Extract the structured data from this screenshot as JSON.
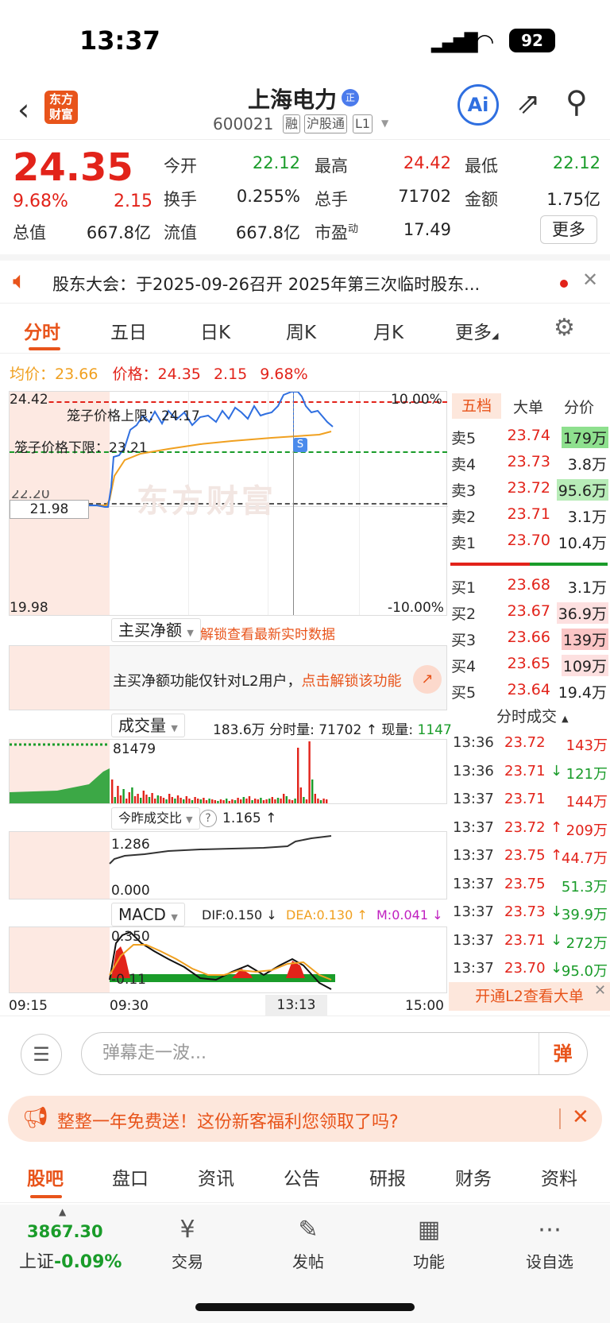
{
  "status": {
    "time": "13:37",
    "battery": "92"
  },
  "header": {
    "logo": "东方财富",
    "name": "上海电力",
    "badge": "正",
    "code": "600021",
    "tags": [
      "融",
      "沪股通",
      "L1"
    ],
    "ai": "Ai"
  },
  "quote": {
    "price": "24.35",
    "pct": "9.68%",
    "change": "2.15",
    "labels": {
      "open": "今开",
      "high": "最高",
      "low": "最低",
      "turnover": "换手",
      "volume": "总手",
      "amount": "金额",
      "mcap": "总值",
      "float": "流值",
      "pe": "市盈",
      "pe_sup": "动"
    },
    "values": {
      "open": "22.12",
      "high": "24.42",
      "low": "22.12",
      "turnover": "0.255%",
      "volume": "71702",
      "amount": "1.75亿",
      "mcap": "667.8亿",
      "float": "667.8亿",
      "pe": "17.49"
    },
    "more": "更多"
  },
  "notice": {
    "text": "股东大会：于2025-09-26召开 2025年第三次临时股东..."
  },
  "tabs": [
    "分时",
    "五日",
    "日K",
    "周K",
    "月K",
    "更多"
  ],
  "info": {
    "avg_label": "均价：",
    "avg": "23.66",
    "price_label": "价格：",
    "price": "24.35",
    "chg": "2.15",
    "pct": "9.68%"
  },
  "chart": {
    "ymax": "24.42",
    "ymin": "19.98",
    "pct_up": "10.00%",
    "pct_dn": "-10.00%",
    "prev_close": "21.98",
    "prev_close_partial": "22.20",
    "cage_up": "笼子价格上限：24.17",
    "cage_dn": "笼子价格下限：23.21",
    "marker": "S",
    "watermark": "东方财富",
    "colors": {
      "price_line": "#2f6fe0",
      "avg_line": "#f0a020",
      "up": "#e2231a",
      "down": "#1a9c2a"
    }
  },
  "netbuy": {
    "dropdown": "主买净额",
    "unlock": "解锁查看最新实时数据",
    "msg": "主买净额功能仅针对L2用户，",
    "msg_link": "点击解锁该功能"
  },
  "volume": {
    "dropdown": "成交量",
    "total": "183.6万",
    "fen_label": "分时量:",
    "fen": "71702",
    "arrow": "↑",
    "xian_label": "现量:",
    "xian": "1147",
    "max": "81479"
  },
  "ratio": {
    "dropdown": "今昨成交比",
    "help": "?",
    "value": "1.165",
    "arrow": "↑",
    "max": "1.286",
    "min": "0.000"
  },
  "macd": {
    "dropdown": "MACD",
    "dif": "DIF:0.150 ↓",
    "dea": "DEA:0.130 ↑",
    "m": "M:0.041 ↓",
    "max": "0.350",
    "min": "-0.11"
  },
  "xaxis": [
    "09:15",
    "09:30",
    "13:13",
    "15:00"
  ],
  "book": {
    "tabs": [
      "五档",
      "大单",
      "分价"
    ],
    "asks": [
      {
        "l": "卖5",
        "p": "23.74",
        "v": "179万",
        "bg": "#8ee08e"
      },
      {
        "l": "卖4",
        "p": "23.73",
        "v": "3.8万",
        "bg": ""
      },
      {
        "l": "卖3",
        "p": "23.72",
        "v": "95.6万",
        "bg": "#b8ecb8"
      },
      {
        "l": "卖2",
        "p": "23.71",
        "v": "3.1万",
        "bg": ""
      },
      {
        "l": "卖1",
        "p": "23.70",
        "v": "10.4万",
        "bg": ""
      }
    ],
    "bids": [
      {
        "l": "买1",
        "p": "23.68",
        "v": "3.1万",
        "bg": ""
      },
      {
        "l": "买2",
        "p": "23.67",
        "v": "36.9万",
        "bg": "#fde0e0"
      },
      {
        "l": "买3",
        "p": "23.66",
        "v": "139万",
        "bg": "#fbc6c6"
      },
      {
        "l": "买4",
        "p": "23.65",
        "v": "109万",
        "bg": "#fde0e0"
      },
      {
        "l": "买5",
        "p": "23.64",
        "v": "19.4万",
        "bg": ""
      }
    ],
    "trades_title": "分时成交",
    "trades": [
      {
        "t": "13:36",
        "p": "23.72",
        "a": "",
        "v": "143万",
        "vc": "red"
      },
      {
        "t": "13:36",
        "p": "23.71",
        "a": "↓",
        "v": "121万",
        "vc": "green"
      },
      {
        "t": "13:37",
        "p": "23.71",
        "a": "",
        "v": "144万",
        "vc": "red"
      },
      {
        "t": "13:37",
        "p": "23.72",
        "a": "↑",
        "v": "209万",
        "vc": "red"
      },
      {
        "t": "13:37",
        "p": "23.75",
        "a": "↑",
        "v": "44.7万",
        "vc": "red"
      },
      {
        "t": "13:37",
        "p": "23.75",
        "a": "",
        "v": "51.3万",
        "vc": "green"
      },
      {
        "t": "13:37",
        "p": "23.73",
        "a": "↓",
        "v": "39.9万",
        "vc": "green"
      },
      {
        "t": "13:37",
        "p": "23.71",
        "a": "↓",
        "v": "272万",
        "vc": "green"
      },
      {
        "t": "13:37",
        "p": "23.70",
        "a": "↓",
        "v": "95.0万",
        "vc": "green"
      }
    ],
    "l2": "开通L2查看大单"
  },
  "danmu": {
    "placeholder": "弹幕走一波...",
    "btn": "弹"
  },
  "promo": {
    "text": "整整一年免费送！这份新客福利您领取了吗?"
  },
  "subtabs": [
    "股吧",
    "盘口",
    "资讯",
    "公告",
    "研报",
    "财务",
    "资料"
  ],
  "bottom": {
    "index_val": "3867.30",
    "index_name": "上证",
    "index_pct": "-0.09%",
    "nav": [
      "交易",
      "发帖",
      "功能",
      "设自选"
    ]
  }
}
